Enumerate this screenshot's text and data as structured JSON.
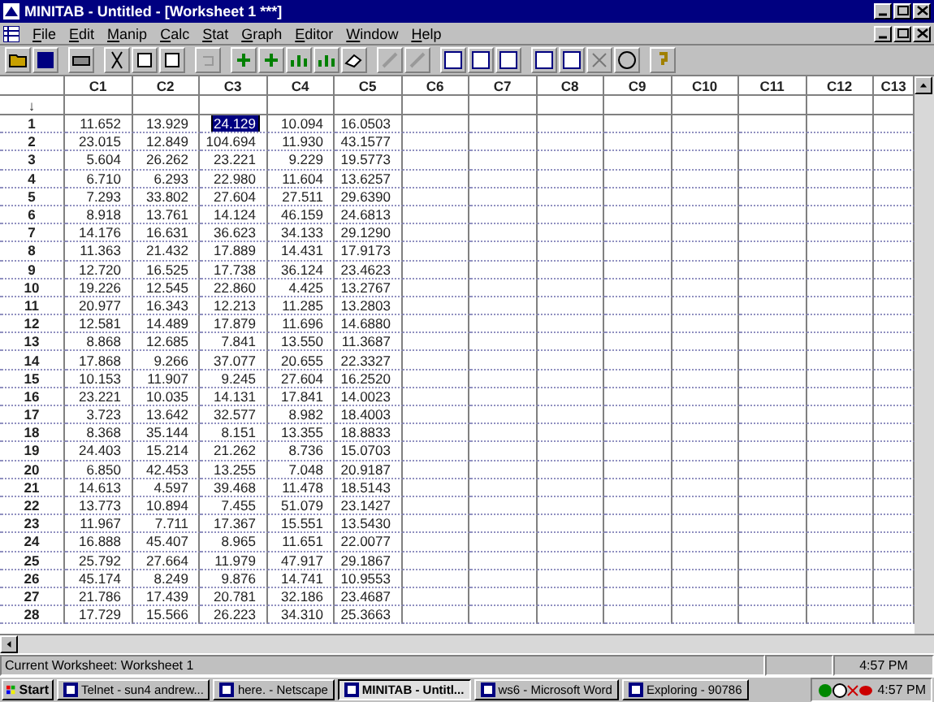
{
  "window": {
    "title": "MINITAB - Untitled - [Worksheet 1 ***]"
  },
  "menu": [
    "File",
    "Edit",
    "Manip",
    "Calc",
    "Stat",
    "Graph",
    "Editor",
    "Window",
    "Help"
  ],
  "worksheet": {
    "columns": [
      "C1",
      "C2",
      "C3",
      "C4",
      "C5",
      "C6",
      "C7",
      "C8",
      "C9",
      "C10",
      "C11",
      "C12",
      "C13"
    ],
    "name_row_marker": "↓",
    "rows": [
      {
        "label": "1",
        "cells": [
          {
            "value": "11.652",
            "selected": false
          },
          {
            "value": "13.929",
            "selected": false
          },
          {
            "value": "24.129",
            "selected": true
          },
          {
            "value": "10.094",
            "selected": false
          },
          {
            "value": "16.0503",
            "selected": false
          }
        ]
      },
      {
        "label": "2",
        "cells": [
          {
            "value": "23.015",
            "selected": false
          },
          {
            "value": "12.849",
            "selected": false
          },
          {
            "value": "104.694",
            "selected": false
          },
          {
            "value": "11.930",
            "selected": false
          },
          {
            "value": "43.1577",
            "selected": false
          }
        ]
      },
      {
        "label": "3",
        "cells": [
          {
            "value": "5.604",
            "selected": false
          },
          {
            "value": "26.262",
            "selected": false
          },
          {
            "value": "23.221",
            "selected": false
          },
          {
            "value": "9.229",
            "selected": false
          },
          {
            "value": "19.5773",
            "selected": false
          }
        ]
      },
      {
        "label": "4",
        "cells": [
          {
            "value": "6.710",
            "selected": false
          },
          {
            "value": "6.293",
            "selected": false
          },
          {
            "value": "22.980",
            "selected": false
          },
          {
            "value": "11.604",
            "selected": false
          },
          {
            "value": "13.6257",
            "selected": false
          }
        ]
      },
      {
        "label": "5",
        "cells": [
          {
            "value": "7.293",
            "selected": false
          },
          {
            "value": "33.802",
            "selected": false
          },
          {
            "value": "27.604",
            "selected": false
          },
          {
            "value": "27.511",
            "selected": false
          },
          {
            "value": "29.6390",
            "selected": false
          }
        ]
      },
      {
        "label": "6",
        "cells": [
          {
            "value": "8.918",
            "selected": false
          },
          {
            "value": "13.761",
            "selected": false
          },
          {
            "value": "14.124",
            "selected": false
          },
          {
            "value": "46.159",
            "selected": false
          },
          {
            "value": "24.6813",
            "selected": false
          }
        ]
      },
      {
        "label": "7",
        "cells": [
          {
            "value": "14.176",
            "selected": false
          },
          {
            "value": "16.631",
            "selected": false
          },
          {
            "value": "36.623",
            "selected": false
          },
          {
            "value": "34.133",
            "selected": false
          },
          {
            "value": "29.1290",
            "selected": false
          }
        ]
      },
      {
        "label": "8",
        "cells": [
          {
            "value": "11.363",
            "selected": false
          },
          {
            "value": "21.432",
            "selected": false
          },
          {
            "value": "17.889",
            "selected": false
          },
          {
            "value": "14.431",
            "selected": false
          },
          {
            "value": "17.9173",
            "selected": false
          }
        ]
      },
      {
        "label": "9",
        "cells": [
          {
            "value": "12.720",
            "selected": false
          },
          {
            "value": "16.525",
            "selected": false
          },
          {
            "value": "17.738",
            "selected": false
          },
          {
            "value": "36.124",
            "selected": false
          },
          {
            "value": "23.4623",
            "selected": false
          }
        ]
      },
      {
        "label": "10",
        "cells": [
          {
            "value": "19.226",
            "selected": false
          },
          {
            "value": "12.545",
            "selected": false
          },
          {
            "value": "22.860",
            "selected": false
          },
          {
            "value": "4.425",
            "selected": false
          },
          {
            "value": "13.2767",
            "selected": false
          }
        ]
      },
      {
        "label": "11",
        "cells": [
          {
            "value": "20.977",
            "selected": false
          },
          {
            "value": "16.343",
            "selected": false
          },
          {
            "value": "12.213",
            "selected": false
          },
          {
            "value": "11.285",
            "selected": false
          },
          {
            "value": "13.2803",
            "selected": false
          }
        ]
      },
      {
        "label": "12",
        "cells": [
          {
            "value": "12.581",
            "selected": false
          },
          {
            "value": "14.489",
            "selected": false
          },
          {
            "value": "17.879",
            "selected": false
          },
          {
            "value": "11.696",
            "selected": false
          },
          {
            "value": "14.6880",
            "selected": false
          }
        ]
      },
      {
        "label": "13",
        "cells": [
          {
            "value": "8.868",
            "selected": false
          },
          {
            "value": "12.685",
            "selected": false
          },
          {
            "value": "7.841",
            "selected": false
          },
          {
            "value": "13.550",
            "selected": false
          },
          {
            "value": "11.3687",
            "selected": false
          }
        ]
      },
      {
        "label": "14",
        "cells": [
          {
            "value": "17.868",
            "selected": false
          },
          {
            "value": "9.266",
            "selected": false
          },
          {
            "value": "37.077",
            "selected": false
          },
          {
            "value": "20.655",
            "selected": false
          },
          {
            "value": "22.3327",
            "selected": false
          }
        ]
      },
      {
        "label": "15",
        "cells": [
          {
            "value": "10.153",
            "selected": false
          },
          {
            "value": "11.907",
            "selected": false
          },
          {
            "value": "9.245",
            "selected": false
          },
          {
            "value": "27.604",
            "selected": false
          },
          {
            "value": "16.2520",
            "selected": false
          }
        ]
      },
      {
        "label": "16",
        "cells": [
          {
            "value": "23.221",
            "selected": false
          },
          {
            "value": "10.035",
            "selected": false
          },
          {
            "value": "14.131",
            "selected": false
          },
          {
            "value": "17.841",
            "selected": false
          },
          {
            "value": "14.0023",
            "selected": false
          }
        ]
      },
      {
        "label": "17",
        "cells": [
          {
            "value": "3.723",
            "selected": false
          },
          {
            "value": "13.642",
            "selected": false
          },
          {
            "value": "32.577",
            "selected": false
          },
          {
            "value": "8.982",
            "selected": false
          },
          {
            "value": "18.4003",
            "selected": false
          }
        ]
      },
      {
        "label": "18",
        "cells": [
          {
            "value": "8.368",
            "selected": false
          },
          {
            "value": "35.144",
            "selected": false
          },
          {
            "value": "8.151",
            "selected": false
          },
          {
            "value": "13.355",
            "selected": false
          },
          {
            "value": "18.8833",
            "selected": false
          }
        ]
      },
      {
        "label": "19",
        "cells": [
          {
            "value": "24.403",
            "selected": false
          },
          {
            "value": "15.214",
            "selected": false
          },
          {
            "value": "21.262",
            "selected": false
          },
          {
            "value": "8.736",
            "selected": false
          },
          {
            "value": "15.0703",
            "selected": false
          }
        ]
      },
      {
        "label": "20",
        "cells": [
          {
            "value": "6.850",
            "selected": false
          },
          {
            "value": "42.453",
            "selected": false
          },
          {
            "value": "13.255",
            "selected": false
          },
          {
            "value": "7.048",
            "selected": false
          },
          {
            "value": "20.9187",
            "selected": false
          }
        ]
      },
      {
        "label": "21",
        "cells": [
          {
            "value": "14.613",
            "selected": false
          },
          {
            "value": "4.597",
            "selected": false
          },
          {
            "value": "39.468",
            "selected": false
          },
          {
            "value": "11.478",
            "selected": false
          },
          {
            "value": "18.5143",
            "selected": false
          }
        ]
      },
      {
        "label": "22",
        "cells": [
          {
            "value": "13.773",
            "selected": false
          },
          {
            "value": "10.894",
            "selected": false
          },
          {
            "value": "7.455",
            "selected": false
          },
          {
            "value": "51.079",
            "selected": false
          },
          {
            "value": "23.1427",
            "selected": false
          }
        ]
      },
      {
        "label": "23",
        "cells": [
          {
            "value": "11.967",
            "selected": false
          },
          {
            "value": "7.711",
            "selected": false
          },
          {
            "value": "17.367",
            "selected": false
          },
          {
            "value": "15.551",
            "selected": false
          },
          {
            "value": "13.5430",
            "selected": false
          }
        ]
      },
      {
        "label": "24",
        "cells": [
          {
            "value": "16.888",
            "selected": false
          },
          {
            "value": "45.407",
            "selected": false
          },
          {
            "value": "8.965",
            "selected": false
          },
          {
            "value": "11.651",
            "selected": false
          },
          {
            "value": "22.0077",
            "selected": false
          }
        ]
      },
      {
        "label": "25",
        "cells": [
          {
            "value": "25.792",
            "selected": false
          },
          {
            "value": "27.664",
            "selected": false
          },
          {
            "value": "11.979",
            "selected": false
          },
          {
            "value": "47.917",
            "selected": false
          },
          {
            "value": "29.1867",
            "selected": false
          }
        ]
      },
      {
        "label": "26",
        "cells": [
          {
            "value": "45.174",
            "selected": false
          },
          {
            "value": "8.249",
            "selected": false
          },
          {
            "value": "9.876",
            "selected": false
          },
          {
            "value": "14.741",
            "selected": false
          },
          {
            "value": "10.9553",
            "selected": false
          }
        ]
      },
      {
        "label": "27",
        "cells": [
          {
            "value": "21.786",
            "selected": false
          },
          {
            "value": "17.439",
            "selected": false
          },
          {
            "value": "20.781",
            "selected": false
          },
          {
            "value": "32.186",
            "selected": false
          },
          {
            "value": "23.4687",
            "selected": false
          }
        ]
      },
      {
        "label": "28",
        "cells": [
          {
            "value": "17.729",
            "selected": false
          },
          {
            "value": "15.566",
            "selected": false
          },
          {
            "value": "26.223",
            "selected": false
          },
          {
            "value": "34.310",
            "selected": false
          },
          {
            "value": "25.3663",
            "selected": false
          }
        ]
      }
    ]
  },
  "status_bar": {
    "text": "Current Worksheet: Worksheet 1",
    "time": "4:57 PM"
  },
  "taskbar": {
    "start": "Start",
    "items": [
      {
        "label": "Telnet - sun4 andrew...",
        "selected": false
      },
      {
        "label": "here. - Netscape",
        "selected": false
      },
      {
        "label": "MINITAB - Untitl...",
        "selected": true
      },
      {
        "label": "ws6 - Microsoft Word",
        "selected": false
      },
      {
        "label": "Exploring - 90786",
        "selected": false
      }
    ],
    "clock": "4:57 PM"
  }
}
